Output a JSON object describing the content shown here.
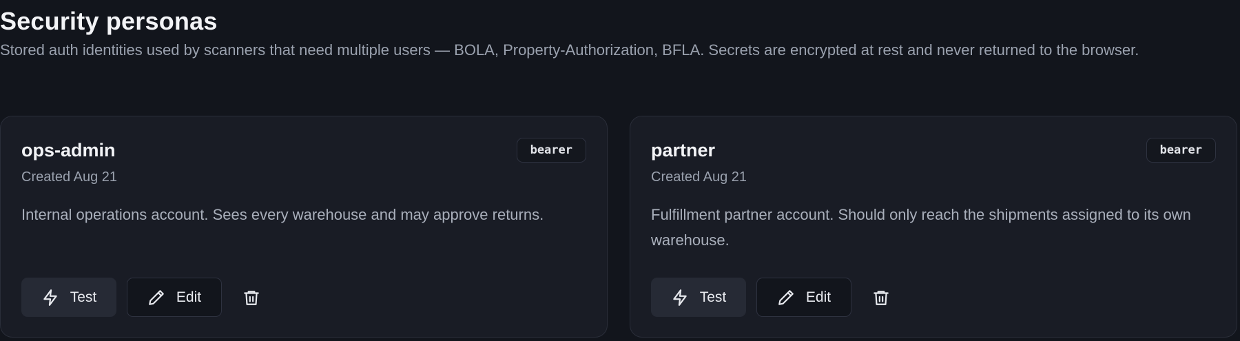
{
  "page": {
    "title": "Security personas",
    "subtitle": "Stored auth identities used by scanners that need multiple users — BOLA, Property-Authorization, BFLA. Secrets are encrypted at rest and never returned to the browser."
  },
  "personas": [
    {
      "name": "ops-admin",
      "created": "Created Aug 21",
      "auth_type": "bearer",
      "description": "Internal operations account. Sees every warehouse and may approve returns.",
      "test_label": "Test",
      "edit_label": "Edit",
      "test_icon": "zap-icon",
      "edit_icon": "pencil-icon",
      "delete_icon": "trash-icon"
    },
    {
      "name": "partner",
      "created": "Created Aug 21",
      "auth_type": "bearer",
      "description": "Fulfillment partner account. Should only reach the shipments assigned to its own warehouse.",
      "test_label": "Test",
      "edit_label": "Edit",
      "test_icon": "zap-icon",
      "edit_icon": "pencil-icon",
      "delete_icon": "trash-icon"
    }
  ],
  "colors": {
    "background": "#12151c",
    "card": "#191c25",
    "card_border": "#2a2e39",
    "text_primary": "#f3f4f7",
    "text_muted": "#9aa1ae",
    "test_button": "#262a35"
  }
}
